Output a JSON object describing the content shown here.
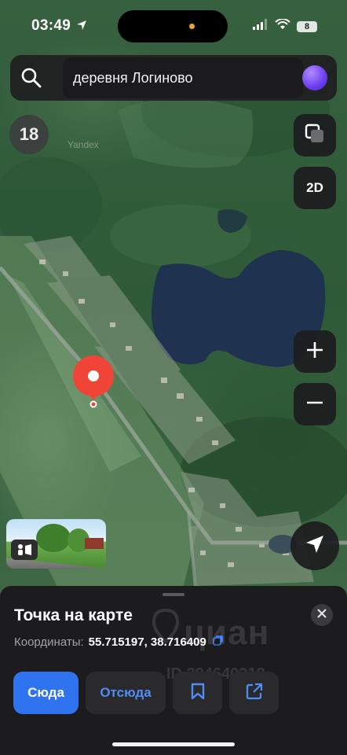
{
  "status_bar": {
    "time": "03:49",
    "battery": "8",
    "icons": [
      "location-arrow-icon",
      "signal-icon",
      "wifi-icon",
      "battery-icon"
    ]
  },
  "search": {
    "query": "деревня Логиново",
    "left_icon": "search-icon",
    "right_icon": "alice-assistant-icon"
  },
  "map": {
    "zoom_level": "18",
    "provider_watermark": "Yandex",
    "mode_button": "2D",
    "controls": [
      "layers-icon",
      "plus-icon",
      "minus-icon",
      "navigation-arrow-icon"
    ],
    "marker_icon": "map-pin-icon",
    "panorama_icon": "panorama-viewer-icon"
  },
  "sheet": {
    "title": "Точка на карте",
    "coords_label": "Координаты:",
    "coords_value": "55.715197, 38.716409",
    "close_icon": "close-icon",
    "copy_icon": "copy-icon",
    "actions": {
      "here": "Сюда",
      "from": "Отсюда",
      "bookmark_icon": "bookmark-icon",
      "share_icon": "share-icon"
    }
  },
  "watermark": {
    "brand": "циан",
    "id_text": "ID 294640318"
  },
  "colors": {
    "accent_blue": "#2f73ee",
    "link_blue": "#4f8df7",
    "pin_red": "#f04436",
    "sheet_bg": "#1c1c1e",
    "lake": "#1f3250"
  }
}
